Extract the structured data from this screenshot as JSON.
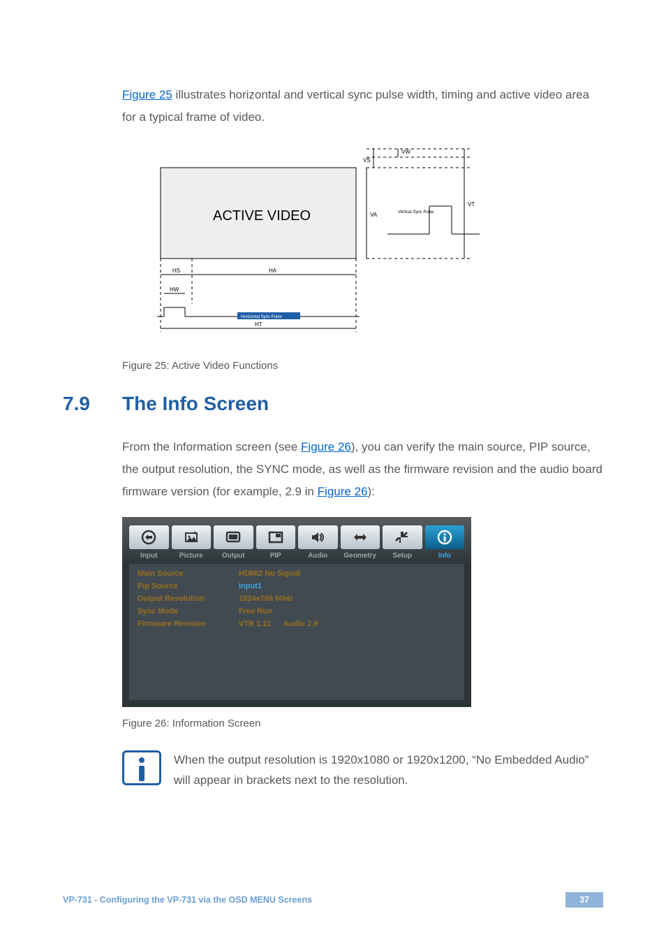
{
  "intro_text_1": "Figure 25",
  "intro_text_2": " illustrates horizontal and vertical sync pulse width, timing and active video area for a typical frame of video.",
  "figure25": {
    "title": "ACTIVE VIDEO",
    "labels": {
      "vw": "VW",
      "vs": "VS",
      "vt": "VT",
      "va": "VA",
      "hs": "HS",
      "ha": "HA",
      "hw": "HW",
      "ht": "HT",
      "hsp": "Horizontal Sync Pulse",
      "vsp": "Vertical Sync Pulse"
    },
    "caption": "Figure 25: Active Video Functions"
  },
  "section": {
    "num": "7.9",
    "title": "The Info Screen"
  },
  "section_para_a": "From the Information screen (see ",
  "section_para_b": "Figure 26",
  "section_para_c": "), you can verify the main source, PIP source, the output resolution, the SYNC mode, as well as the firmware revision and the audio board firmware version (for example, 2.9 in ",
  "section_para_d": "Figure 26",
  "section_para_e": "):",
  "osd": {
    "tabs": [
      {
        "label": "Input"
      },
      {
        "label": "Picture"
      },
      {
        "label": "Output"
      },
      {
        "label": "PIP"
      },
      {
        "label": "Audio"
      },
      {
        "label": "Geometry"
      },
      {
        "label": "Setup"
      },
      {
        "label": "Info"
      }
    ],
    "active_tab_index": 7,
    "rows": [
      {
        "key": "Main Source",
        "val1": "HDMI2 No Signal",
        "val2": ""
      },
      {
        "key": "Pip Source",
        "val1": "Input1",
        "val2": "",
        "highlight": true
      },
      {
        "key": "Output Resolution",
        "val1": "1024x768 60Hz",
        "val2": ""
      },
      {
        "key": "Sync Mode",
        "val1": "Free Run",
        "val2": ""
      },
      {
        "key": "Firmware Revision",
        "val1": "VTB 1.11",
        "val2": "Audio 2.9"
      }
    ],
    "caption": "Figure 26: Information Screen"
  },
  "note_text": "When the output resolution is 1920x1080 or 1920x1200, “No Embedded Audio” will appear in brackets next to the resolution.",
  "footer": {
    "left": "VP-731 - Configuring the VP-731 via the OSD MENU Screens",
    "right": "37"
  }
}
